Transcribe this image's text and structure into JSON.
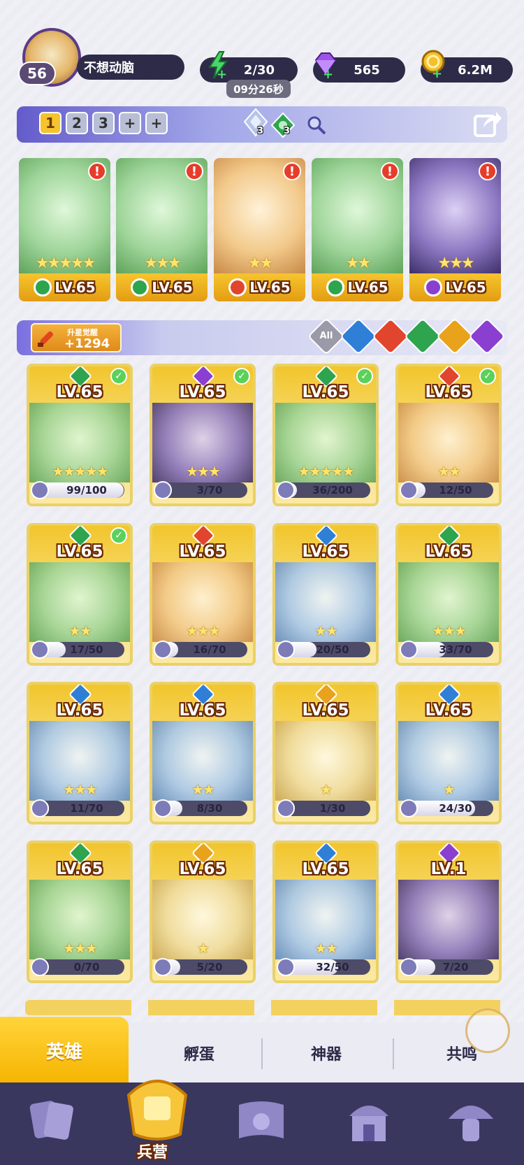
{
  "player": {
    "level": "56",
    "name": "不想动脑"
  },
  "resources": {
    "energy": "2/30",
    "energy_timer": "09分26秒",
    "gems": "565",
    "gold": "6.2M"
  },
  "team": {
    "slots": [
      "1",
      "2",
      "3",
      "+",
      "+"
    ],
    "active_slot": "1",
    "buff_a_count": "3",
    "buff_b_count": "3"
  },
  "lineup": [
    {
      "level": "LV.65",
      "element": "nature",
      "stars": 5
    },
    {
      "level": "LV.65",
      "element": "nature",
      "stars": 3
    },
    {
      "level": "LV.65",
      "element": "fire",
      "stars": 2
    },
    {
      "level": "LV.65",
      "element": "nature",
      "stars": 2
    },
    {
      "level": "LV.65",
      "element": "dark",
      "stars": 3
    }
  ],
  "awaken": {
    "label": "升星觉醒",
    "value": "+1294"
  },
  "filters": [
    {
      "label": "All",
      "color": "#9a9aa8"
    },
    {
      "label": "",
      "color": "#2f7fd6"
    },
    {
      "label": "",
      "color": "#e2452d"
    },
    {
      "label": "",
      "color": "#2ea44f"
    },
    {
      "label": "",
      "color": "#e8a21c"
    },
    {
      "label": "",
      "color": "#8b3fd1"
    }
  ],
  "heroes": [
    {
      "level": "LV.65",
      "element": "nature",
      "progress": "99/100",
      "fraction": 0.99,
      "stars": 5,
      "ready": true
    },
    {
      "level": "LV.65",
      "element": "dark",
      "progress": "3/70",
      "fraction": 0.04,
      "stars": 3,
      "ready": true
    },
    {
      "level": "LV.65",
      "element": "nature",
      "progress": "36/200",
      "fraction": 0.18,
      "stars": 5,
      "ready": true
    },
    {
      "level": "LV.65",
      "element": "fire",
      "progress": "12/50",
      "fraction": 0.24,
      "stars": 2,
      "ready": true
    },
    {
      "level": "LV.65",
      "element": "nature",
      "progress": "17/50",
      "fraction": 0.34,
      "stars": 2,
      "ready": true
    },
    {
      "level": "LV.65",
      "element": "fire",
      "progress": "16/70",
      "fraction": 0.23,
      "stars": 3,
      "ready": false
    },
    {
      "level": "LV.65",
      "element": "water",
      "progress": "20/50",
      "fraction": 0.4,
      "stars": 2,
      "ready": false
    },
    {
      "level": "LV.65",
      "element": "nature",
      "progress": "33/70",
      "fraction": 0.47,
      "stars": 3,
      "ready": false
    },
    {
      "level": "LV.65",
      "element": "water",
      "progress": "11/70",
      "fraction": 0.16,
      "stars": 3,
      "ready": false
    },
    {
      "level": "LV.65",
      "element": "water",
      "progress": "8/30",
      "fraction": 0.27,
      "stars": 2,
      "ready": false
    },
    {
      "level": "LV.65",
      "element": "light",
      "progress": "1/30",
      "fraction": 0.03,
      "stars": 1,
      "ready": false
    },
    {
      "level": "LV.65",
      "element": "water",
      "progress": "24/30",
      "fraction": 0.8,
      "stars": 1,
      "ready": false
    },
    {
      "level": "LV.65",
      "element": "nature",
      "progress": "0/70",
      "fraction": 0.0,
      "stars": 3,
      "ready": false
    },
    {
      "level": "LV.65",
      "element": "light",
      "progress": "5/20",
      "fraction": 0.25,
      "stars": 1,
      "ready": false
    },
    {
      "level": "LV.65",
      "element": "water",
      "progress": "32/50",
      "fraction": 0.64,
      "stars": 2,
      "ready": false
    },
    {
      "level": "LV.1",
      "element": "dark",
      "progress": "7/20",
      "fraction": 0.35,
      "stars": 0,
      "ready": false
    }
  ],
  "sub_tabs": [
    "英雄",
    "孵蛋",
    "神器",
    "共鸣"
  ],
  "nav": {
    "active_label": "兵营"
  },
  "colors": {
    "nature": "#2ea44f",
    "fire": "#e2452d",
    "water": "#2f7fd6",
    "light": "#e8a21c",
    "dark": "#8b3fd1",
    "gold": "#f6c52e"
  }
}
